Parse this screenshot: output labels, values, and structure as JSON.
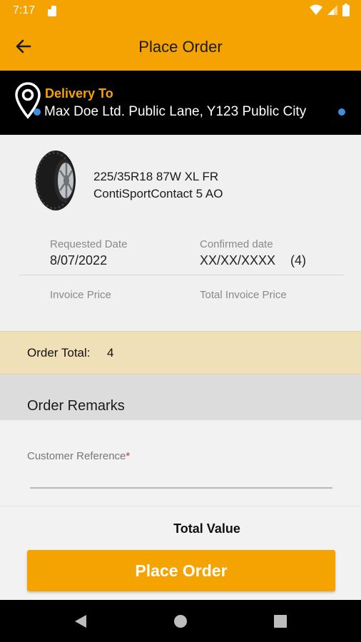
{
  "status_bar": {
    "time": "7:17"
  },
  "app_bar": {
    "title": "Place Order"
  },
  "delivery": {
    "label": "Delivery To",
    "address": "Max Doe Ltd. Public Lane, Y123 Public City"
  },
  "product": {
    "line1": "225/35R18 87W XL FR",
    "line2": "ContiSportContact 5 AO"
  },
  "fields": {
    "requested_date_label": "Requested Date",
    "requested_date_value": "8/07/2022",
    "confirmed_date_label": "Confirmed date",
    "confirmed_date_value": "XX/XX/XXXX",
    "confirmed_qty": "(4)",
    "invoice_price_label": "Invoice Price",
    "total_invoice_price_label": "Total Invoice Price"
  },
  "order_total": {
    "label": "Order Total:",
    "value": "4"
  },
  "remarks": {
    "title": "Order Remarks",
    "customer_reference_label": "Customer Reference",
    "required_mark": "*",
    "customer_reference_value": ""
  },
  "summary": {
    "total_value_label": "Total Value"
  },
  "actions": {
    "place_order_label": "Place Order"
  },
  "colors": {
    "accent": "#f5a300",
    "band": "#efe0b8",
    "dot": "#3d8fe0"
  }
}
